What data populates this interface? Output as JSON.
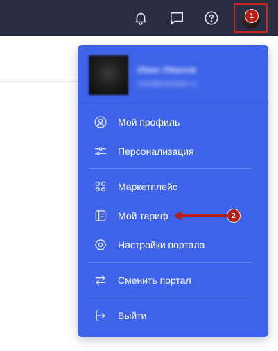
{
  "topbar": {
    "background": "#2a2d42",
    "icons": [
      "bell-icon",
      "chat-icon",
      "help-icon"
    ]
  },
  "annotations": {
    "badge_1": "1",
    "badge_2": "2",
    "color": "#b81e16"
  },
  "profile": {
    "name": "Иван Иванов",
    "email": "ivan@example.ru"
  },
  "menu": {
    "background": "#3e63e8",
    "items": [
      {
        "label": "Мой профиль",
        "icon": "user-circle-icon"
      },
      {
        "label": "Персонализация",
        "icon": "sliders-icon"
      },
      {
        "label": "Маркетплейс",
        "icon": "apps-grid-icon"
      },
      {
        "label": "Мой тариф",
        "icon": "tariff-document-icon"
      },
      {
        "label": "Настройки портала",
        "icon": "gear-icon"
      },
      {
        "label": "Сменить портал",
        "icon": "swap-arrows-icon"
      },
      {
        "label": "Выйти",
        "icon": "logout-icon"
      }
    ]
  }
}
